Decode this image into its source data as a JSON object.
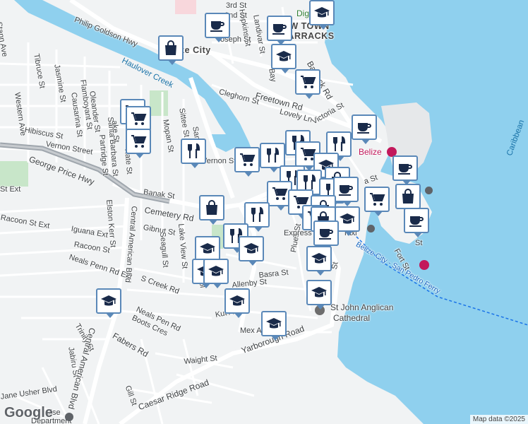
{
  "map": {
    "attribution": "Map data ©2025",
    "logo": "Google",
    "colors": {
      "water": "#8fd0ee",
      "land": "#f1f3f4",
      "park": "#c8e6c9",
      "road": "#ffffff",
      "highway": "#9fa6ad",
      "marker_border": "#5a88b8"
    }
  },
  "labels": {
    "philip_goldson": "Philip Goldson Hwy",
    "belize_city": "Belize City",
    "haulover": "Haulover Creek",
    "george_price": "George Price Hwy",
    "cemetery": "Cemetery Rd",
    "central_american_1": "Central American Blvd",
    "central_american_2": "Central American Blvd",
    "freetown": "Freetown Rd",
    "barrack": "Barrack Rd",
    "new_town": "NEW TOWN",
    "barracks": "BARRACKS",
    "digi_park": "Digi Park",
    "belize_poi": "Belize",
    "anglican_1": "St John Anglican",
    "anglican_2": "Cathedral",
    "ferry": "Belize City - San Pedro Ferry",
    "caribbean": "Caribbean",
    "express": "Express",
    "taxi": "Taxi",
    "yarborough": "Yarborough Road",
    "caesar": "Caesar Ridge Road",
    "fabers": "Fabers Rd",
    "stann": "Stann Ave",
    "tibruce": "Tibruce St",
    "jasmine": "Jasmine St",
    "western": "Western Ave",
    "flamboyant": "Flamboyant St",
    "causarina": "Causarina St",
    "oleander": "Oleander St",
    "hibiscus": "Hibiscus St",
    "vernon_street": "Vernon Street",
    "vernon_st": "Vernon St",
    "santa_barbara": "Santa Barbara St",
    "partridge": "Partridge St",
    "kate": "Kate St",
    "mopan": "Mopan St",
    "sittee": "Sittee St",
    "san": "San",
    "banak": "Banak St",
    "gibnut": "Gibnut St",
    "racoon_ext": "Racoon St Ext",
    "racoon_st": "Racoon St",
    "iguana": "Iguana Ext",
    "neals_penn": "Neals Penn Rd Ext",
    "neals_pen_rd": "Neals Pen Rd",
    "boots": "Boots Cres",
    "s_creek": "S Creek Rd",
    "elston": "Elston Kerr St",
    "seagull": "Seagull St",
    "lake_view": "Lake View St",
    "st_ext": "St Ext",
    "cleghorn": "Cleghorn St",
    "lovely": "Lovely Ln",
    "victoria": "Victoria St",
    "basra": "Basra St",
    "allenby": "Allenby St",
    "plues": "Plues St",
    "kut": "Kut A",
    "mex": "Mex Ave",
    "waight": "Waight St",
    "gill": "Gill St",
    "jabiru": "Jabiru St",
    "trinity": "Trinity St",
    "jane_usher": "Jane Usher Blvd",
    "fort": "Fort St",
    "hopkins": "Hopkins St",
    "landivar": "Landivar St",
    "joseph": "oseph St",
    "third": "3rd St",
    "second": "2nd St",
    "bay": "Bay",
    "dol": "Dol",
    "sa": "S",
    "a_st": "a St",
    "ev": "Ev",
    "lake_st": "ake St",
    "cise": "cise",
    "department": "Department",
    "st_short": "St",
    "st_short2": "St"
  },
  "markers": [
    {
      "type": "cafe"
    },
    {
      "type": "cafe"
    },
    {
      "type": "school"
    },
    {
      "type": "shopping"
    },
    {
      "type": "school"
    },
    {
      "type": "grocery"
    },
    {
      "type": "grocery"
    },
    {
      "type": "grocery"
    },
    {
      "type": "cafe"
    },
    {
      "type": "restaurant"
    },
    {
      "type": "restaurant"
    },
    {
      "type": "grocery"
    },
    {
      "type": "restaurant"
    },
    {
      "type": "grocery"
    },
    {
      "type": "restaurant"
    },
    {
      "type": "grocery"
    },
    {
      "type": "school"
    },
    {
      "type": "shopping"
    },
    {
      "type": "restaurant"
    },
    {
      "type": "cafe"
    },
    {
      "type": "grocery"
    },
    {
      "type": "restaurant"
    },
    {
      "type": "grocery"
    },
    {
      "type": "restaurant"
    },
    {
      "type": "cafe"
    },
    {
      "type": "shopping"
    },
    {
      "type": "grocery"
    },
    {
      "type": "shopping"
    },
    {
      "type": "grocery"
    },
    {
      "type": "shopping"
    },
    {
      "type": "school"
    },
    {
      "type": "shopping"
    },
    {
      "type": "cafe"
    },
    {
      "type": "cafe"
    },
    {
      "type": "restaurant"
    },
    {
      "type": "restaurant"
    },
    {
      "type": "school"
    },
    {
      "type": "school"
    },
    {
      "type": "school"
    },
    {
      "type": "school"
    },
    {
      "type": "school"
    },
    {
      "type": "school"
    },
    {
      "type": "school"
    },
    {
      "type": "school"
    },
    {
      "type": "school"
    }
  ]
}
